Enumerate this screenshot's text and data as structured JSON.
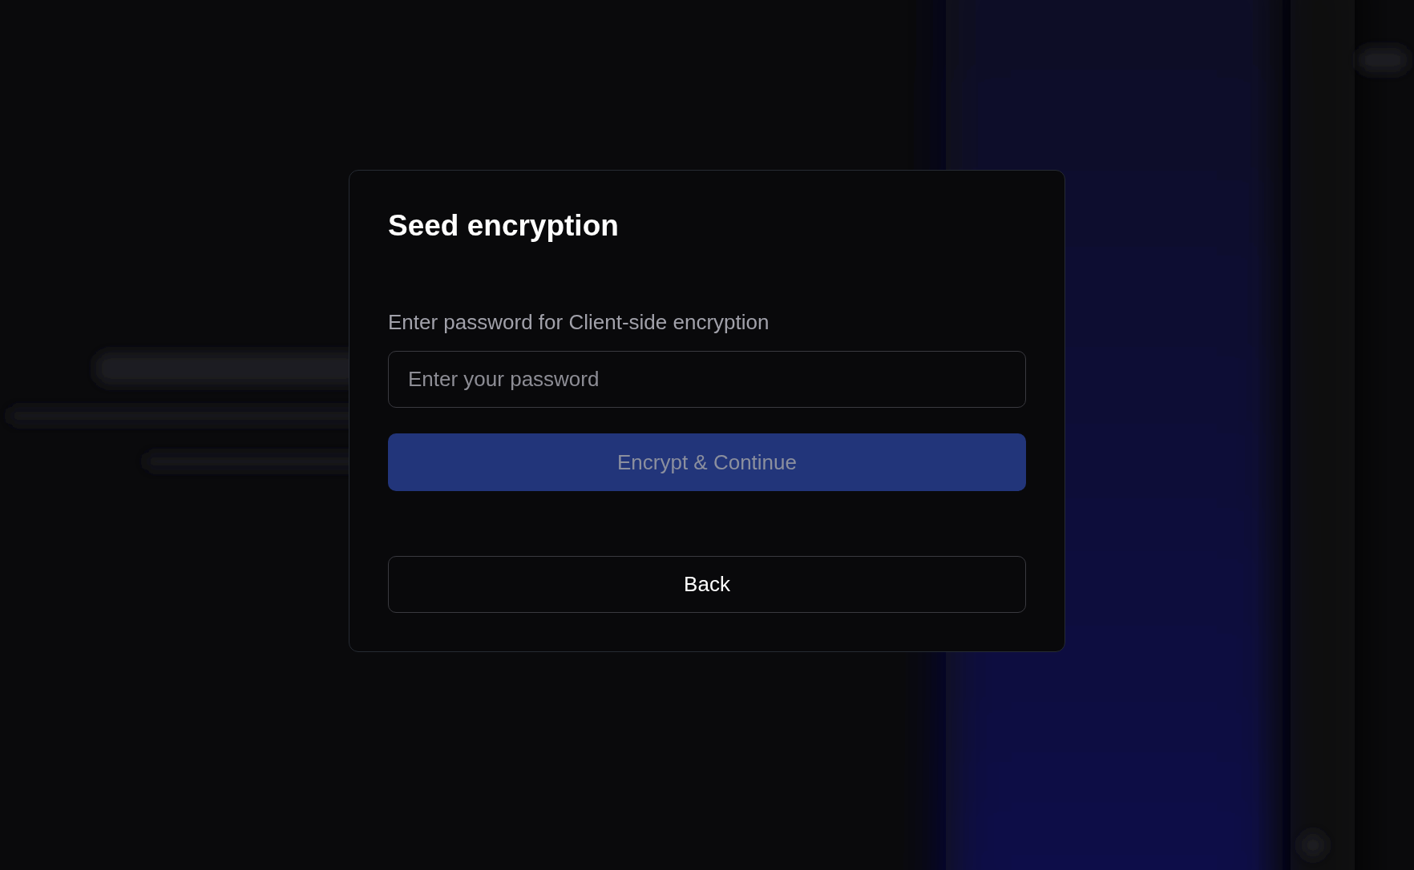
{
  "dialog": {
    "title": "Seed encryption",
    "password_label": "Enter password for Client-side encryption",
    "password_field": {
      "placeholder": "Enter your password"
    },
    "encrypt_button": {
      "label": "Encrypt & Continue",
      "disabled": true
    },
    "back_button": {
      "label": "Back"
    }
  }
}
